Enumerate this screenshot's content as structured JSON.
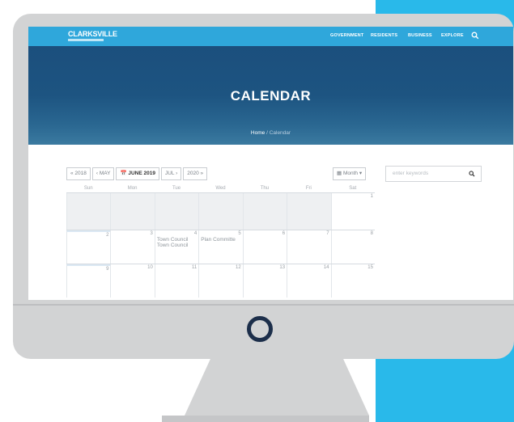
{
  "colors": {
    "accent_panel": "#29b9ea",
    "navbar": "#2fa7db",
    "hero": "#1b4f7d",
    "monitor": "#d2d3d4"
  },
  "site": {
    "logo": "CLARKSVILLE",
    "nav": [
      "GOVERNMENT",
      "RESIDENTS",
      "BUSINESS",
      "EXPLORE"
    ],
    "search_icon": "search-icon"
  },
  "hero": {
    "title": "CALENDAR"
  },
  "breadcrumb": {
    "home": "Home",
    "sep": "/",
    "current": "Calendar"
  },
  "toolbar": {
    "prev_year": "« 2018",
    "prev_month": "‹ MAY",
    "current": "JUNE 2019",
    "next_month": "JUL ›",
    "next_year": "2020 »",
    "view": "Month"
  },
  "search": {
    "placeholder": "enter keywords"
  },
  "calendar": {
    "weekdays": [
      "Sun",
      "Mon",
      "Tue",
      "Wed",
      "Thu",
      "Fri",
      "Sat"
    ],
    "week1": [
      "",
      "",
      "",
      "",
      "",
      "",
      "1"
    ],
    "week2": [
      "2",
      "3",
      "4",
      "5",
      "6",
      "7",
      "8"
    ],
    "week3": [
      "9",
      "10",
      "11",
      "12",
      "13",
      "14",
      "15"
    ],
    "events": {
      "tue": [
        "Town Council",
        "Town Council"
      ],
      "wed": [
        "Plan Committe"
      ]
    }
  }
}
